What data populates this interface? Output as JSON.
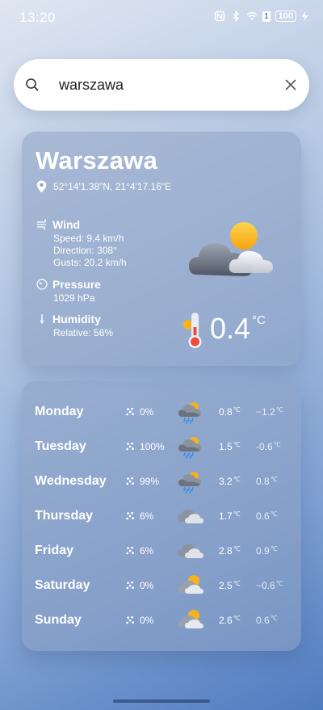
{
  "status_bar": {
    "time": "13:20",
    "sim_label": "1",
    "battery": "100"
  },
  "search": {
    "value": "warszawa",
    "icon": "search-icon",
    "clear_icon": "close-icon"
  },
  "current": {
    "city": "Warszawa",
    "coordinates": "52°14'1.38\"N, 21°4'17.16\"E",
    "wind": {
      "label": "Wind",
      "speed": "Speed: 9.4 km/h",
      "direction": "Direction: 308°",
      "gusts": "Gusts: 20.2 km/h"
    },
    "pressure": {
      "label": "Pressure",
      "value": "1029 hPa"
    },
    "humidity": {
      "label": "Humidity",
      "value": "Relative: 56%"
    },
    "temperature": "0.4",
    "unit": "°C",
    "condition_icon": "partly-cloudy-icon"
  },
  "forecast": [
    {
      "day": "Monday",
      "precip": "0%",
      "icon": "sun-cloud-rain-icon",
      "high": "0.8",
      "low": "−1.2"
    },
    {
      "day": "Tuesday",
      "precip": "100%",
      "icon": "sun-cloud-rain-icon",
      "high": "1.5",
      "low": "-0.6"
    },
    {
      "day": "Wednesday",
      "precip": "99%",
      "icon": "sun-cloud-rain-icon",
      "high": "3.2",
      "low": "0.8"
    },
    {
      "day": "Thursday",
      "precip": "6%",
      "icon": "cloudy-icon",
      "high": "1.7",
      "low": "0.6"
    },
    {
      "day": "Friday",
      "precip": "6%",
      "icon": "cloudy-icon",
      "high": "2.8",
      "low": "0.9"
    },
    {
      "day": "Saturday",
      "precip": "0%",
      "icon": "partly-cloudy-icon",
      "high": "2.5",
      "low": "−0.6"
    },
    {
      "day": "Sunday",
      "precip": "0%",
      "icon": "partly-cloudy-icon",
      "high": "2.6",
      "low": "0.6"
    }
  ],
  "deg_unit": "℃",
  "colors": {
    "sun": "#f7b21b",
    "cloud": "#d9dde6",
    "rain": "#3a8ee6"
  }
}
